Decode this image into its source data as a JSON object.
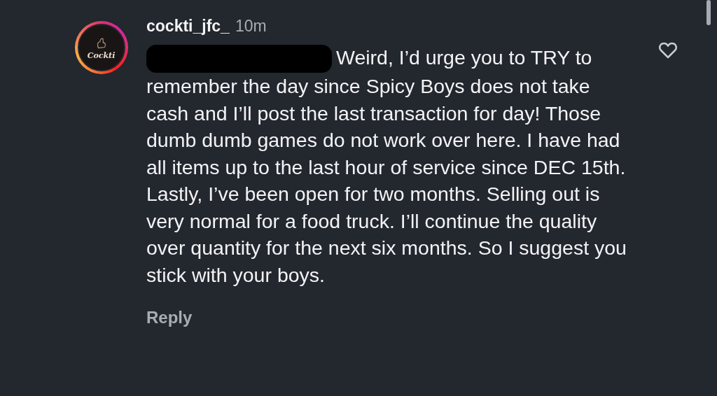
{
  "comment": {
    "avatar": {
      "logo_text": "Cockti",
      "has_story": true
    },
    "username": "cockti_jfc_",
    "time": "10m",
    "text": "Weird, I’d urge you to TRY to remember the day since Spicy Boys does not take cash and I’ll post the last transaction for day! Those dumb dumb games do not work over here. I have had all items up to the last hour of service since DEC 15th. Lastly, I’ve been open for two months. Selling out is very normal for a food truck. I’ll continue the quality over quantity for the next six months. So I suggest you stick with your boys.",
    "redacted": true,
    "liked": false,
    "reply_label": "Reply"
  }
}
